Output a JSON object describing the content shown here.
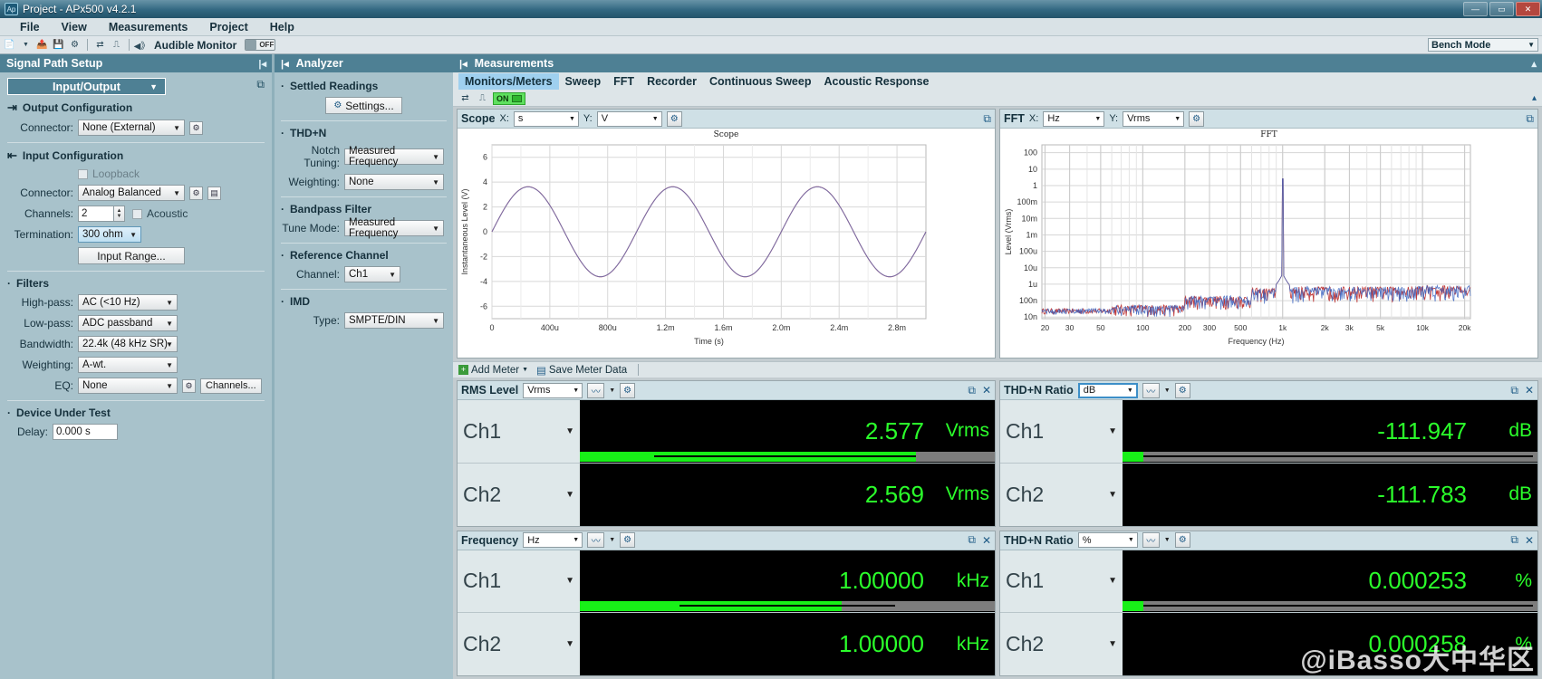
{
  "window": {
    "title": "Project - APx500 v4.2.1",
    "app_icon": "ap-logo-icon",
    "buttons": {
      "minimize": "—",
      "maximize": "▭",
      "close": "✕"
    }
  },
  "menu": {
    "items": [
      "File",
      "View",
      "Measurements",
      "Project",
      "Help"
    ]
  },
  "toolbar": {
    "icons": [
      "new-document-icon",
      "dropdown-caret-icon",
      "open-folder-icon",
      "save-icon",
      "settings-gear-icon",
      "signal-path-icon",
      "waveform-icon",
      "speaker-icon"
    ],
    "audible_monitor_label": "Audible Monitor",
    "audible_monitor_state": "OFF",
    "bench_mode_label": "Bench Mode"
  },
  "signal_path": {
    "panel_title": "Signal Path Setup",
    "selector": "Input/Output",
    "output_configuration": {
      "heading": "Output Configuration",
      "connector_label": "Connector:",
      "connector_value": "None (External)"
    },
    "input_configuration": {
      "heading": "Input Configuration",
      "loopback_label": "Loopback",
      "connector_label": "Connector:",
      "connector_value": "Analog Balanced",
      "channels_label": "Channels:",
      "channels_value": "2",
      "acoustic_label": "Acoustic",
      "termination_label": "Termination:",
      "termination_value": "300 ohm",
      "input_range_button": "Input Range..."
    },
    "filters": {
      "heading": "Filters",
      "highpass_label": "High-pass:",
      "highpass_value": "AC (<10 Hz)",
      "lowpass_label": "Low-pass:",
      "lowpass_value": "ADC passband",
      "bandwidth_label": "Bandwidth:",
      "bandwidth_value": "22.4k (48 kHz SR)",
      "weighting_label": "Weighting:",
      "weighting_value": "A-wt.",
      "eq_label": "EQ:",
      "eq_value": "None",
      "channels_button": "Channels..."
    },
    "dut": {
      "heading": "Device Under Test",
      "delay_label": "Delay:",
      "delay_value": "0.000 s"
    }
  },
  "analyzer": {
    "panel_title": "Analyzer",
    "settled_readings": {
      "heading": "Settled Readings",
      "settings_button": "Settings..."
    },
    "thdn": {
      "heading": "THD+N",
      "notch_tuning_label": "Notch Tuning:",
      "notch_tuning_value": "Measured Frequency",
      "weighting_label": "Weighting:",
      "weighting_value": "None"
    },
    "bandpass": {
      "heading": "Bandpass Filter",
      "tune_mode_label": "Tune Mode:",
      "tune_mode_value": "Measured Frequency"
    },
    "reference_channel": {
      "heading": "Reference Channel",
      "channel_label": "Channel:",
      "channel_value": "Ch1"
    },
    "imd": {
      "heading": "IMD",
      "type_label": "Type:",
      "type_value": "SMPTE/DIN"
    }
  },
  "measurements": {
    "panel_title": "Measurements",
    "tabs": [
      "Monitors/Meters",
      "Sweep",
      "FFT",
      "Recorder",
      "Continuous Sweep",
      "Acoustic Response"
    ],
    "active_tab": "Monitors/Meters",
    "generator_state": "ON",
    "add_meter_label": "Add Meter",
    "save_meter_data_label": "Save Meter Data"
  },
  "scope": {
    "name": "Scope",
    "x_label": "X:",
    "x_unit": "s",
    "y_label": "Y:",
    "y_unit": "V"
  },
  "fft": {
    "name": "FFT",
    "x_label": "X:",
    "x_unit": "Hz",
    "y_label": "Y:",
    "y_unit": "Vrms"
  },
  "chart_data": [
    {
      "type": "line",
      "title": "Scope",
      "xlabel": "Time (s)",
      "ylabel": "Instantaneous Level (V)",
      "xticks": [
        "0",
        "400u",
        "800u",
        "1.2m",
        "1.6m",
        "2.0m",
        "2.4m",
        "2.8m"
      ],
      "xtick_values": [
        0,
        0.0004,
        0.0008,
        0.0012,
        0.0016,
        0.002,
        0.0024,
        0.0028
      ],
      "yticks": [
        "6",
        "4",
        "2",
        "0",
        "-2",
        "-4",
        "-6"
      ],
      "ylim": [
        -7,
        7
      ],
      "xlim": [
        0,
        0.003
      ],
      "grid": true,
      "legend": "none",
      "series": [
        {
          "name": "Ch1",
          "color": "#b05060",
          "waveform": "sine",
          "amplitude": 3.63,
          "frequency_hz": 1000,
          "phase": 0
        },
        {
          "name": "Ch2",
          "color": "#7a6fa8",
          "waveform": "sine",
          "amplitude": 3.62,
          "frequency_hz": 1000,
          "phase": 0
        }
      ]
    },
    {
      "type": "line",
      "title": "FFT",
      "xlabel": "Frequency (Hz)",
      "ylabel": "Level (Vrms)",
      "xscale": "log",
      "yscale": "log",
      "xticks": [
        "20",
        "30",
        "50",
        "100",
        "200",
        "300",
        "500",
        "1k",
        "2k",
        "3k",
        "5k",
        "10k",
        "20k"
      ],
      "xtick_values": [
        20,
        30,
        50,
        100,
        200,
        300,
        500,
        1000,
        2000,
        3000,
        5000,
        10000,
        20000
      ],
      "yticks": [
        "100",
        "10",
        "1",
        "100m",
        "10m",
        "1m",
        "100u",
        "10u",
        "1u",
        "100n",
        "10n"
      ],
      "ytick_values": [
        100,
        10,
        1,
        0.1,
        0.01,
        0.001,
        0.0001,
        1e-05,
        1e-06,
        1e-07,
        1e-08
      ],
      "grid": true,
      "peak": {
        "frequency_hz": 1000,
        "level_vrms": 2.577
      },
      "noise_floor_vrms": 2e-07,
      "series": [
        {
          "name": "Ch1",
          "color": "#c03a3a"
        },
        {
          "name": "Ch2",
          "color": "#3a63c0"
        }
      ]
    }
  ],
  "meters": [
    {
      "id": "rms-level",
      "title": "RMS Level",
      "unit": "Vrms",
      "rows": [
        {
          "channel": "Ch1",
          "value": "2.577",
          "unit": "Vrms",
          "bar_pct": 81,
          "peak_pct": 81
        },
        {
          "channel": "Ch2",
          "value": "2.569",
          "unit": "Vrms",
          "bar_pct": 81,
          "peak_pct": 81
        }
      ]
    },
    {
      "id": "thdn-ratio-db",
      "title": "THD+N Ratio",
      "unit": "dB",
      "unit_focused": true,
      "rows": [
        {
          "channel": "Ch1",
          "value": "-111.947",
          "unit": "dB",
          "bar_pct": 5,
          "peak_pct": 5
        },
        {
          "channel": "Ch2",
          "value": "-111.783",
          "unit": "dB",
          "bar_pct": 5,
          "peak_pct": 5
        }
      ]
    },
    {
      "id": "frequency",
      "title": "Frequency",
      "unit": "Hz",
      "rows": [
        {
          "channel": "Ch1",
          "value": "1.00000",
          "unit": "kHz",
          "bar_pct": 63,
          "peak_pct": 63
        },
        {
          "channel": "Ch2",
          "value": "1.00000",
          "unit": "kHz",
          "bar_pct": 63,
          "peak_pct": 63
        }
      ]
    },
    {
      "id": "thdn-ratio-pct",
      "title": "THD+N Ratio",
      "unit": "%",
      "rows": [
        {
          "channel": "Ch1",
          "value": "0.000253",
          "unit": "%",
          "bar_pct": 5,
          "peak_pct": 5
        },
        {
          "channel": "Ch2",
          "value": "0.000258",
          "unit": "%",
          "bar_pct": 5,
          "peak_pct": 5
        }
      ]
    }
  ],
  "watermark": {
    "text": "@iBasso大中华区"
  },
  "colors": {
    "accent": "#4e8094",
    "panel_bg": "#a8c2cb",
    "readout_green": "#2bff2b",
    "tab_active": "#9fd0ef",
    "ch1": "#c03a3a",
    "ch2": "#3a63c0"
  }
}
